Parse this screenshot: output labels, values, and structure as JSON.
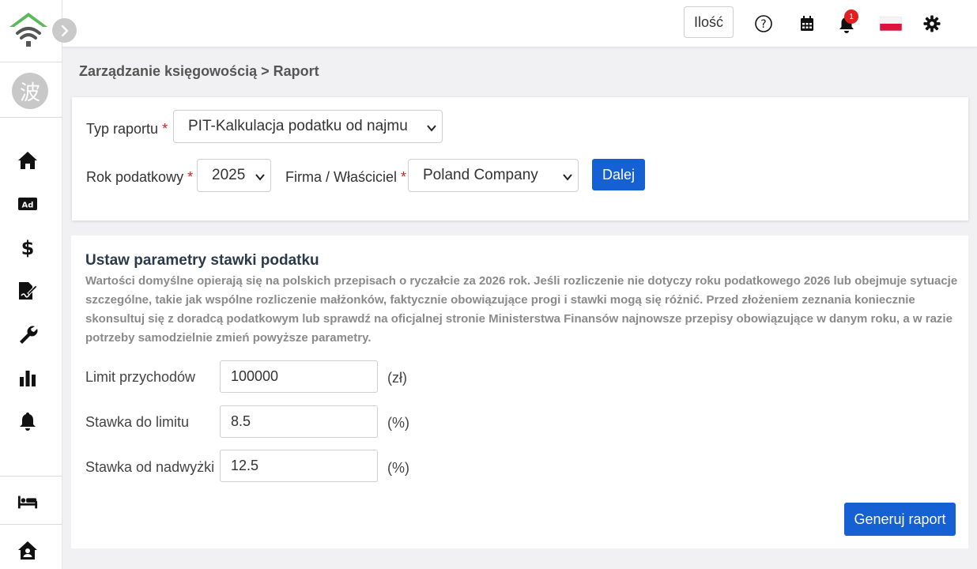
{
  "sidebar": {
    "avatar_char": "波",
    "items": [
      {
        "name": "home-icon"
      },
      {
        "name": "ad-icon",
        "label": "Ad"
      },
      {
        "name": "dollar-icon"
      },
      {
        "name": "file-signature-icon"
      },
      {
        "name": "wrench-icon"
      },
      {
        "name": "bar-chart-icon"
      },
      {
        "name": "bell-icon"
      },
      {
        "name": "bed-icon"
      },
      {
        "name": "house-user-icon"
      }
    ]
  },
  "topbar": {
    "qty_label": "Ilość",
    "notification_count": "1"
  },
  "breadcrumb": "Zarządzanie księgowością > Raport",
  "filters": {
    "report_type_label": "Typ raportu",
    "report_type_value": "PIT-Kalkulacja podatku od najmu",
    "tax_year_label": "Rok podatkowy",
    "tax_year_value": "2025",
    "company_label": "Firma / Właściciel",
    "company_value": "Poland Company",
    "required_mark": "*",
    "next_button": "Dalej"
  },
  "params": {
    "title": "Ustaw parametry stawki podatku",
    "description": "Wartości domyślne opierają się na polskich przepisach o ryczałcie za 2026 rok. Jeśli rozliczenie nie dotyczy roku podatkowego 2026 lub obejmuje sytuacje szczególne, takie jak wspólne rozliczenie małżonków, faktycznie obowiązujące progi i stawki mogą się różnić. Przed złożeniem zeznania koniecznie skonsultuj się z doradcą podatkowym lub sprawdź na oficjalnej stronie Ministerstwa Finansów najnowsze przepisy obowiązujące w danym roku, a w razie potrzeby samodzielnie zmień powyższe parametry.",
    "fields": [
      {
        "label": "Limit przychodów",
        "value": "100000",
        "unit": "(zł)"
      },
      {
        "label": "Stawka do limitu",
        "value": "8.5",
        "unit": "(%)"
      },
      {
        "label": "Stawka od nadwyżki",
        "value": "12.5",
        "unit": "(%)"
      }
    ],
    "generate_button": "Generuj raport"
  },
  "colors": {
    "primary": "#1560d2",
    "logo_green": "#5cb85c",
    "required": "#d02020",
    "badge": "#e02020"
  }
}
